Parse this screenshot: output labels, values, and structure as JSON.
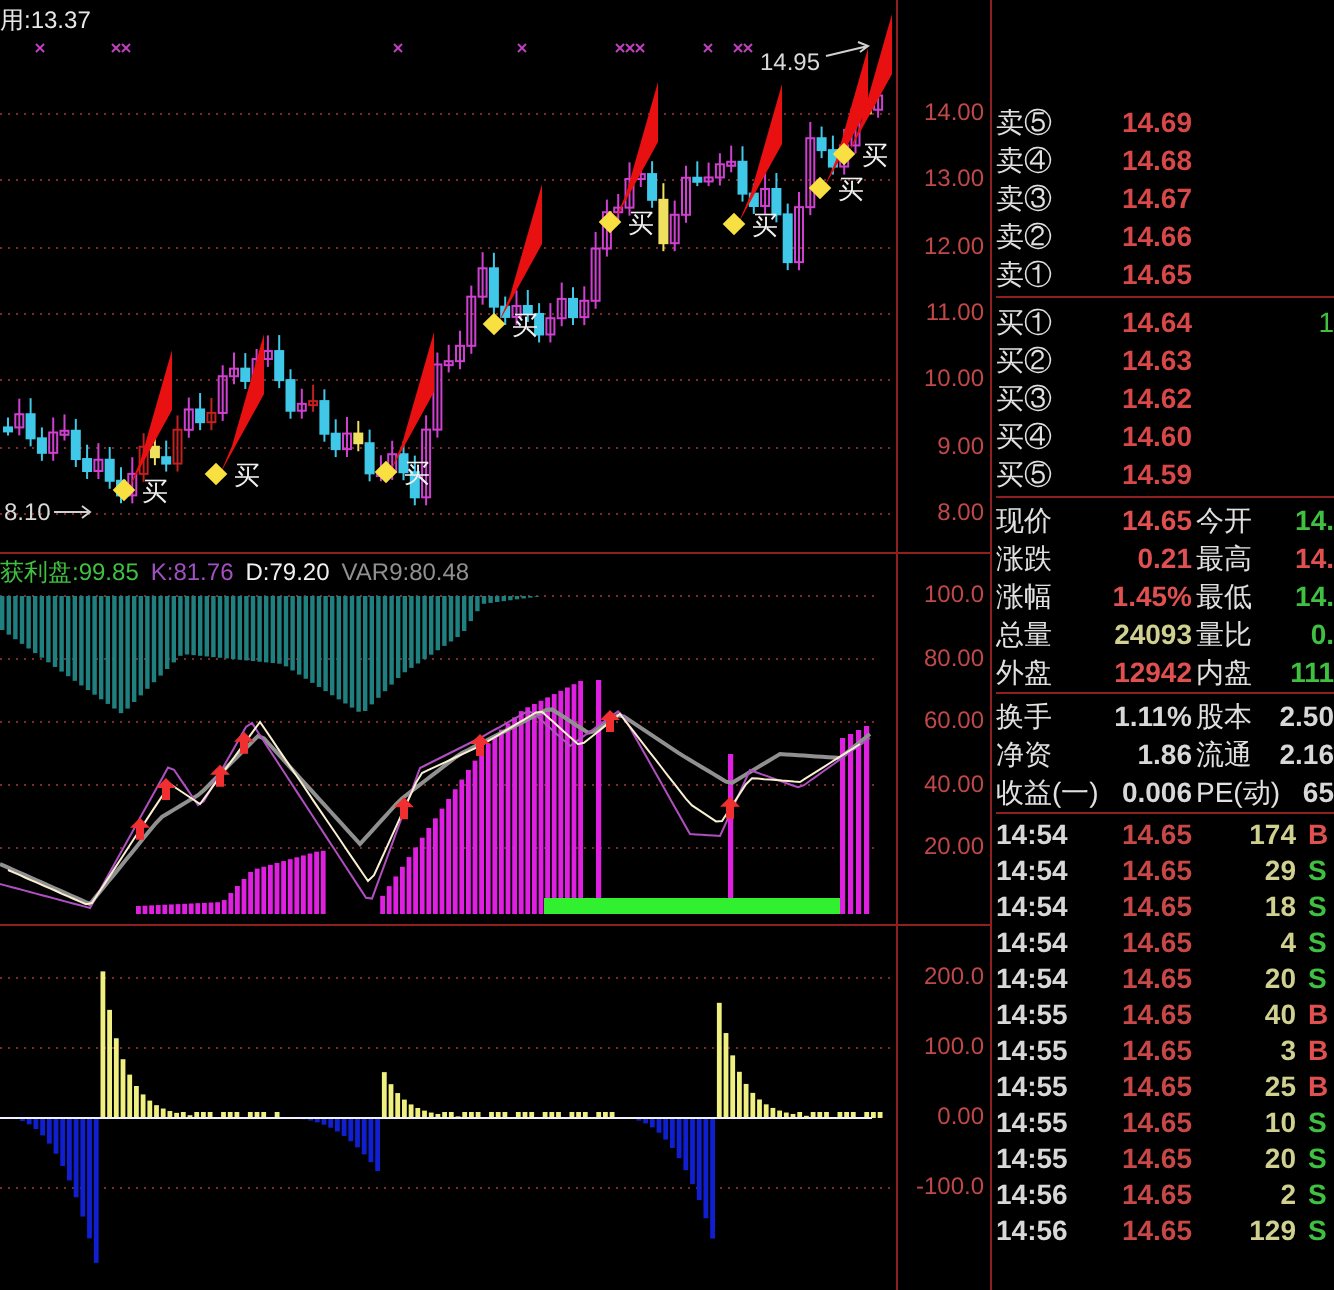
{
  "main_chart": {
    "indicator_label": "用:13.37",
    "high_label": "14.95",
    "low_label": "8.10",
    "buy_signals": [
      {
        "label": "买"
      },
      {
        "label": "买"
      },
      {
        "label": "买"
      },
      {
        "label": "买"
      },
      {
        "label": "买"
      },
      {
        "label": "买"
      },
      {
        "label": "买"
      },
      {
        "label": "买"
      }
    ],
    "y_axis": [
      "14.00",
      "13.00",
      "12.00",
      "11.00",
      "10.00",
      "9.00",
      "8.00"
    ]
  },
  "oscillator": {
    "legend": [
      {
        "text": "获利盘:99.85",
        "color": "#40c040"
      },
      {
        "text": "K:81.76",
        "color": "#a050c0"
      },
      {
        "text": "D:79.20",
        "color": "#f0f0f0"
      },
      {
        "text": "VAR9:80.48",
        "color": "#909090"
      }
    ],
    "y_axis": [
      "100.0",
      "80.00",
      "60.00",
      "40.00",
      "20.00"
    ]
  },
  "histogram": {
    "y_axis": [
      "200.0",
      "100.0",
      "0.00",
      "-100.0"
    ]
  },
  "order_book": {
    "asks": [
      {
        "label": "卖⑤",
        "price": "14.69"
      },
      {
        "label": "卖④",
        "price": "14.68"
      },
      {
        "label": "卖③",
        "price": "14.67"
      },
      {
        "label": "卖②",
        "price": "14.66"
      },
      {
        "label": "卖①",
        "price": "14.65"
      }
    ],
    "bids": [
      {
        "label": "买①",
        "price": "14.64",
        "volume": "1"
      },
      {
        "label": "买②",
        "price": "14.63"
      },
      {
        "label": "买③",
        "price": "14.62"
      },
      {
        "label": "买④",
        "price": "14.60"
      },
      {
        "label": "买⑤",
        "price": "14.59"
      }
    ]
  },
  "quote": [
    {
      "cells": [
        {
          "label": "现价",
          "value": "14.65",
          "color": "#e05050"
        },
        {
          "label": "今开",
          "value": "14.",
          "color": "#40c040"
        }
      ]
    },
    {
      "cells": [
        {
          "label": "涨跌",
          "value": "0.21",
          "color": "#e05050"
        },
        {
          "label": "最高",
          "value": "14.",
          "color": "#e05050"
        }
      ]
    },
    {
      "cells": [
        {
          "label": "涨幅",
          "value": "1.45%",
          "color": "#e05050"
        },
        {
          "label": "最低",
          "value": "14.",
          "color": "#40c040"
        }
      ]
    },
    {
      "cells": [
        {
          "label": "总量",
          "value": "24093",
          "color": "#d0d090"
        },
        {
          "label": "量比",
          "value": "0.",
          "color": "#40c040"
        }
      ]
    },
    {
      "cells": [
        {
          "label": "外盘",
          "value": "12942",
          "color": "#e05050"
        },
        {
          "label": "内盘",
          "value": "111",
          "color": "#40c040"
        }
      ]
    }
  ],
  "fundamentals": [
    {
      "label": "换手",
      "value": "1.11%",
      "label2": "股本",
      "value2": "2.50"
    },
    {
      "label": "净资",
      "value": "1.86",
      "label2": "流通",
      "value2": "2.16"
    },
    {
      "label": "收益(一)",
      "value": "0.006",
      "label2": "PE(动)",
      "value2": "65"
    }
  ],
  "trades": [
    {
      "time": "14:54",
      "price": "14.65",
      "volume": "174",
      "side": "B",
      "kind": "buy"
    },
    {
      "time": "14:54",
      "price": "14.65",
      "volume": "29",
      "side": "S",
      "kind": "sell"
    },
    {
      "time": "14:54",
      "price": "14.65",
      "volume": "18",
      "side": "S",
      "kind": "sell"
    },
    {
      "time": "14:54",
      "price": "14.65",
      "volume": "4",
      "side": "S",
      "kind": "sell"
    },
    {
      "time": "14:54",
      "price": "14.65",
      "volume": "20",
      "side": "S",
      "kind": "sell"
    },
    {
      "time": "14:55",
      "price": "14.65",
      "volume": "40",
      "side": "B",
      "kind": "buy"
    },
    {
      "time": "14:55",
      "price": "14.65",
      "volume": "3",
      "side": "B",
      "kind": "buy"
    },
    {
      "time": "14:55",
      "price": "14.65",
      "volume": "25",
      "side": "B",
      "kind": "buy"
    },
    {
      "time": "14:55",
      "price": "14.65",
      "volume": "10",
      "side": "S",
      "kind": "sell"
    },
    {
      "time": "14:55",
      "price": "14.65",
      "volume": "20",
      "side": "S",
      "kind": "sell"
    },
    {
      "time": "14:56",
      "price": "14.65",
      "volume": "2",
      "side": "S",
      "kind": "sell"
    },
    {
      "time": "14:56",
      "price": "14.65",
      "volume": "129",
      "side": "S",
      "kind": "sell"
    }
  ]
}
